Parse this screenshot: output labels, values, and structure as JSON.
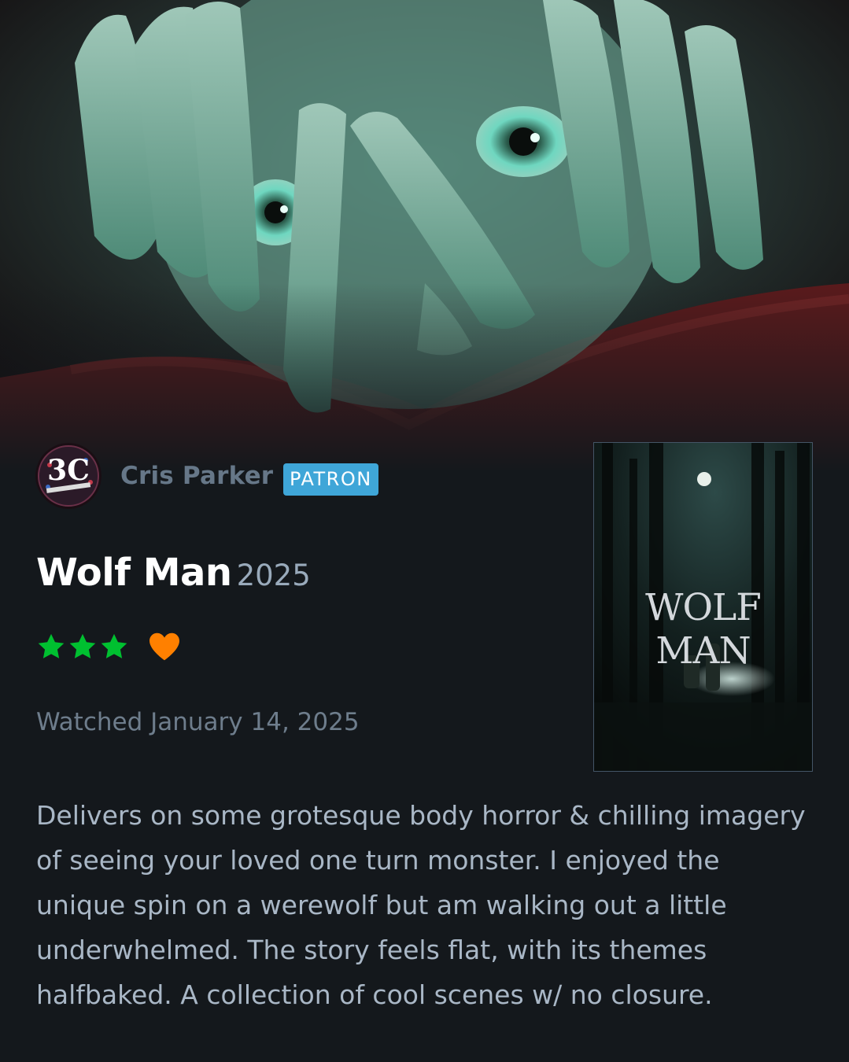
{
  "review": {
    "username": "Cris Parker",
    "badge": "PATRON",
    "avatar_text": "3C",
    "film_title": "Wolf Man",
    "film_year": "2025",
    "rating_stars": 3,
    "liked": true,
    "watched_text": "Watched January 14, 2025",
    "body": "Delivers on some grotesque body horror & chilling imagery of seeing your loved one turn monster. I enjoyed the unique spin on a werewolf but am walking out a little underwhelmed. The story feels flat, with its themes halfbaked. A collection of cool scenes w/ no closure.",
    "poster_title": "WOLF MAN"
  },
  "colors": {
    "background": "#14181c",
    "star": "#00c030",
    "heart": "#ff8000",
    "badge": "#3fa6d8",
    "username": "#667788"
  },
  "icons": {
    "star": "star-icon",
    "heart": "heart-icon"
  }
}
